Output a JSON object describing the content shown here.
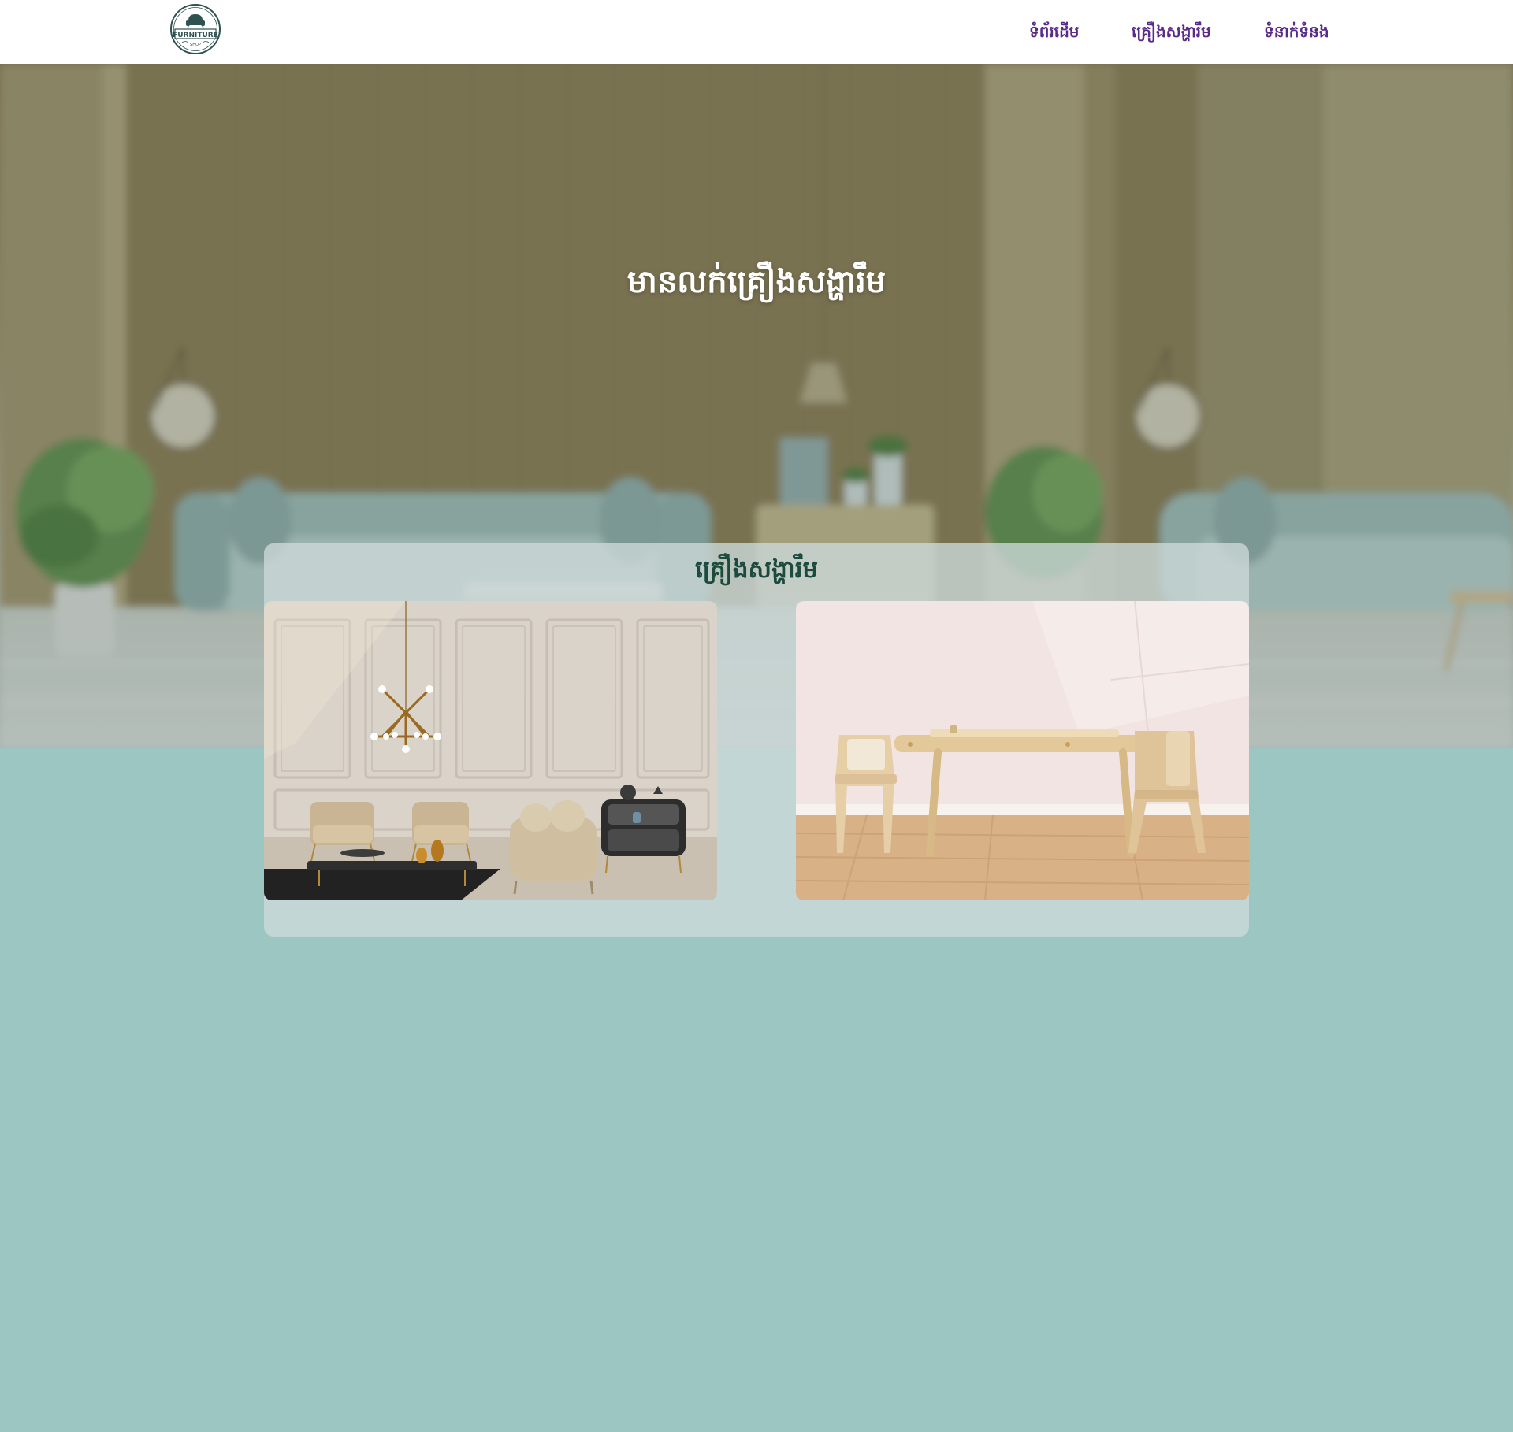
{
  "header": {
    "logo": {
      "icon": "armchair-icon",
      "text": "FURNITURE",
      "subtext": "SHOP"
    },
    "nav": [
      {
        "label": "ទំព័រដើម"
      },
      {
        "label": "គ្រឿងសង្ហារឹម"
      },
      {
        "label": "ទំនាក់ទំនង"
      }
    ]
  },
  "hero": {
    "title": "មានលក់គ្រឿងសង្ហារឹម"
  },
  "products": {
    "title": "គ្រឿងសង្ហារឹម",
    "items": [
      {
        "image": "living-room-image"
      },
      {
        "image": "kids-table-chairs-image"
      }
    ]
  },
  "colors": {
    "nav_text": "#5a2a8a",
    "page_background": "#9cc6c2",
    "panel_title": "#1c4a3e",
    "header_background": "#ffffff"
  }
}
